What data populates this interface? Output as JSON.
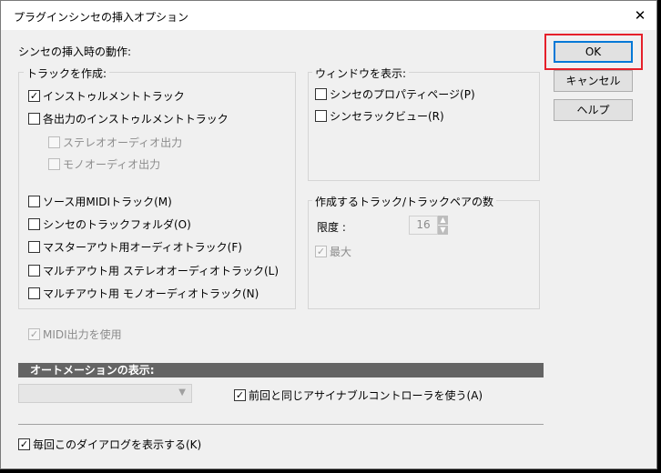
{
  "dialog": {
    "title": "プラグインシンセの挿入オプション",
    "close_glyph": "✕"
  },
  "buttons": {
    "ok": "OK",
    "cancel": "キャンセル",
    "help": "ヘルプ"
  },
  "insert_behavior_label": "シンセの挿入時の動作:",
  "create_tracks": {
    "label": "トラックを作成:",
    "instrument_track": {
      "label": "インストゥルメントトラック",
      "checked": true
    },
    "per_output_instrument": {
      "label": "各出力のインストゥルメントトラック",
      "checked": false
    },
    "stereo_audio_out": {
      "label": "ステレオオーディオ出力",
      "checked": false
    },
    "mono_audio_out": {
      "label": "モノオーディオ出力",
      "checked": false
    },
    "source_midi_track": {
      "label": "ソース用MIDIトラック(M)",
      "checked": false
    },
    "synth_track_folder": {
      "label": "シンセのトラックフォルダ(O)",
      "checked": false
    },
    "master_out_audio": {
      "label": "マスターアウト用オーディオトラック(F)",
      "checked": false
    },
    "multi_out_stereo": {
      "label": "マルチアウト用 ステレオオーディオトラック(L)",
      "checked": false
    },
    "multi_out_mono": {
      "label": "マルチアウト用 モノオーディオトラック(N)",
      "checked": false
    }
  },
  "show_window": {
    "label": "ウィンドウを表示:",
    "synth_property_page": {
      "label": "シンセのプロパティページ(P)",
      "checked": false
    },
    "synth_rack_view": {
      "label": "シンセラックビュー(R)",
      "checked": false
    }
  },
  "track_pairs": {
    "label": "作成するトラック/トラックペアの数",
    "limit_label": "限度 :",
    "limit_value": "16",
    "max": {
      "label": "最大",
      "checked": true
    }
  },
  "use_midi_output": {
    "label": "MIDI出力を使用",
    "checked": true
  },
  "automation": {
    "label": "オートメーションの表示:",
    "dropdown_value": "",
    "same_assignable": {
      "label": "前回と同じアサイナブルコントローラを使う(A)",
      "checked": true
    }
  },
  "show_dialog_every_time": {
    "label": "毎回このダイアログを表示する(K)",
    "checked": true
  },
  "colors": {
    "highlight": "#e5202a",
    "default_button_border": "#0078d7",
    "section_bar": "#646464"
  }
}
